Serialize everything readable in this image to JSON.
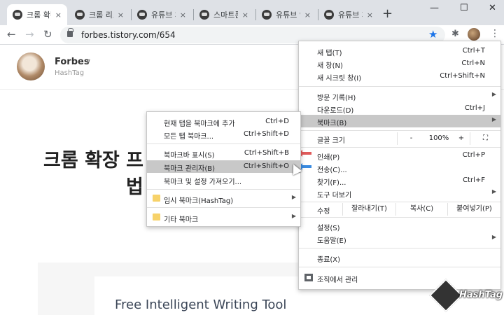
{
  "tabs": [
    {
      "label": "크롬 확장",
      "active": true
    },
    {
      "label": "크롬 리스"
    },
    {
      "label": "유튜브 채"
    },
    {
      "label": "스마트폰"
    },
    {
      "label": "유튜브 영"
    },
    {
      "label": "유튜브 재"
    }
  ],
  "icons": {
    "close": "×",
    "newtab": "+",
    "minimize": "—",
    "maximize": "☐",
    "window_close": "✕",
    "back": "←",
    "forward": "→",
    "reload": "↻",
    "star": "★",
    "extensions": "✱",
    "kebab": "⋮",
    "chevron": "∨",
    "arrow": "▶",
    "fullscreen": "⛶"
  },
  "address": {
    "url": "forbes.tistory.com/654"
  },
  "blog": {
    "name": "Forbes",
    "subtitle": "HashTag"
  },
  "article": {
    "headline_line1": "크롬 확장 프",
    "headline_line2": "법"
  },
  "ad": {
    "title": "Free Intelligent Writing Tool"
  },
  "menu": {
    "new_tab": {
      "label": "새 탭(T)",
      "shortcut": "Ctrl+T"
    },
    "new_window": {
      "label": "새 창(N)",
      "shortcut": "Ctrl+N"
    },
    "incognito": {
      "label": "새 시크릿 창(I)",
      "shortcut": "Ctrl+Shift+N"
    },
    "history": {
      "label": "방문 기록(H)"
    },
    "downloads": {
      "label": "다운로드(D)",
      "shortcut": "Ctrl+J"
    },
    "bookmarks": {
      "label": "북마크(B)"
    },
    "zoom": {
      "label": "글꼴 크기",
      "minus": "-",
      "value": "100%",
      "plus": "+"
    },
    "print": {
      "label": "인쇄(P)",
      "shortcut": "Ctrl+P"
    },
    "cast": {
      "label": "전송(C)..."
    },
    "find": {
      "label": "찾기(F)...",
      "shortcut": "Ctrl+F"
    },
    "more_tools": {
      "label": "도구 더보기"
    },
    "edit": {
      "label": "수정",
      "cut": "잘라내기(T)",
      "copy": "복사(C)",
      "paste": "붙여넣기(P)"
    },
    "settings": {
      "label": "설정(S)"
    },
    "help": {
      "label": "도움말(E)"
    },
    "exit": {
      "label": "종료(X)"
    },
    "managed": {
      "label": "조직에서 관리"
    }
  },
  "submenu": {
    "bookmark_tab": {
      "label": "현재 탭을 북마크에 추가",
      "shortcut": "Ctrl+D"
    },
    "bookmark_all": {
      "label": "모든 탭 북마크...",
      "shortcut": "Ctrl+Shift+D"
    },
    "show_bar": {
      "label": "북마크바 표시(S)",
      "shortcut": "Ctrl+Shift+B"
    },
    "manager": {
      "label": "북마크 관리자(B)",
      "shortcut": "Ctrl+Shift+O"
    },
    "import": {
      "label": "북마크 및 설정 가져오기..."
    },
    "folder_temp": {
      "label": "임시 북마크(HashTag)"
    },
    "folder_other": {
      "label": "기타 북마크"
    }
  },
  "watermark": {
    "text": "HashTag"
  }
}
